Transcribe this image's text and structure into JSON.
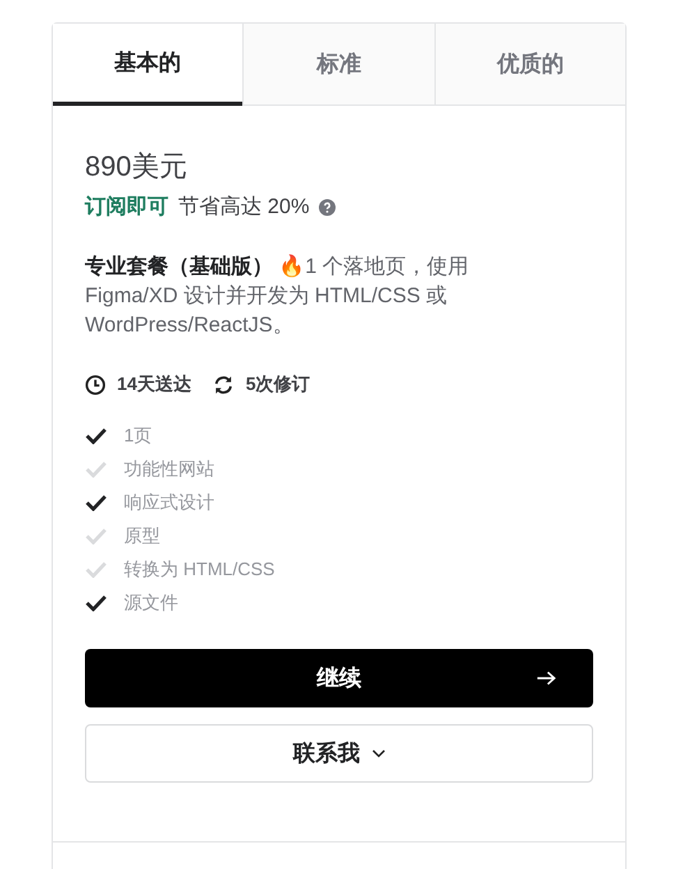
{
  "tabs": [
    {
      "label": "基本的",
      "selected": true
    },
    {
      "label": "标准",
      "selected": false
    },
    {
      "label": "优质的",
      "selected": false
    }
  ],
  "price": "890美元",
  "subscribe": {
    "label": "订阅即可",
    "note": "节省高达 20%",
    "help": true
  },
  "package": {
    "description": "**专业套餐（基础版）** 🔥1 个落地页，使用 Figma/XD 设计并开发为 HTML/CSS 或 WordPress/ReactJS。"
  },
  "delivery": [
    {
      "kind": "time",
      "label": "14天送达"
    },
    {
      "kind": "revisions",
      "label": "5次修订"
    }
  ],
  "features": [
    {
      "label": "1页",
      "checked": true
    },
    {
      "label": "功能性网站",
      "checked": false
    },
    {
      "label": "响应式设计",
      "checked": true
    },
    {
      "label": "原型",
      "checked": false
    },
    {
      "label": "转换为 HTML/CSS",
      "checked": false
    },
    {
      "label": "源文件",
      "checked": true
    }
  ],
  "continue_button": "继续",
  "contact_button": "联系我"
}
